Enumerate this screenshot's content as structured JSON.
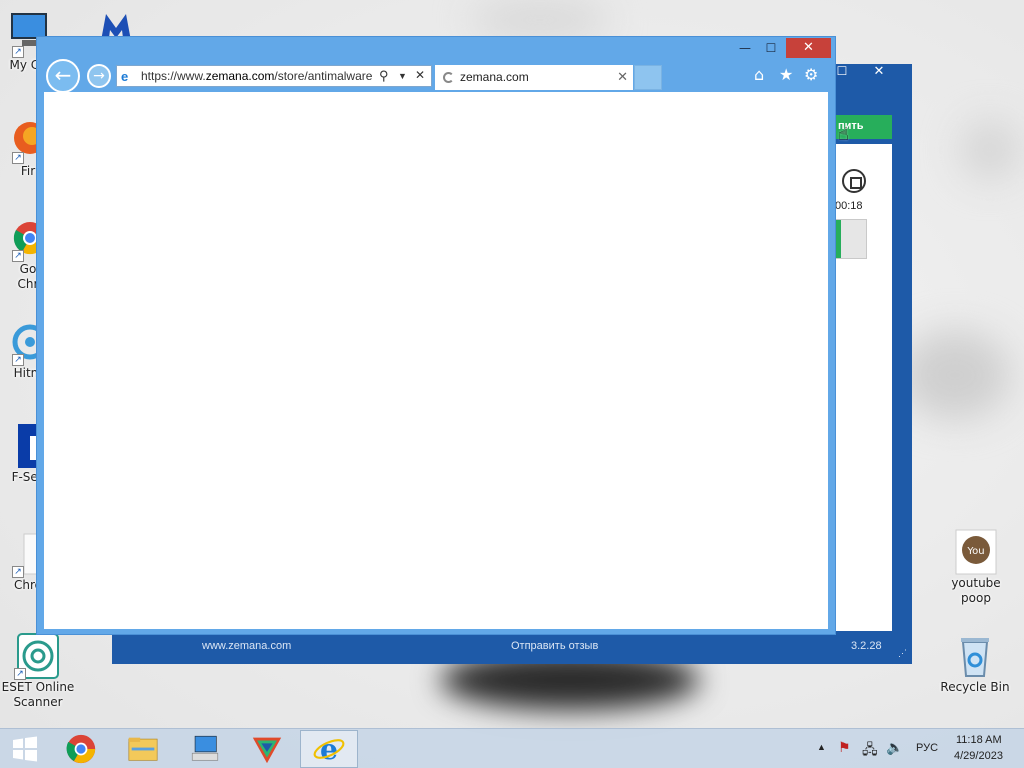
{
  "desktop": {
    "icons_left": [
      {
        "label": "My Co",
        "icon": "computer-icon"
      },
      {
        "label": "",
        "icon": "malwarebytes-icon"
      },
      {
        "label": "Fir",
        "icon": "firefox-icon"
      },
      {
        "label": "Go\nChr",
        "icon": "chrome-icon"
      },
      {
        "label": "Hitm",
        "icon": "hitmanpro-icon"
      },
      {
        "label": "F-Sec",
        "icon": "fsecure-icon"
      },
      {
        "label": "Chro",
        "icon": "chrome-file-icon"
      },
      {
        "label": "ESET Online\nScanner",
        "icon": "eset-icon"
      }
    ],
    "icons_right": [
      {
        "label": "youtube\npoop",
        "icon": "youtube-icon"
      },
      {
        "label": "Recycle Bin",
        "icon": "recycle-bin-icon"
      }
    ]
  },
  "zemana": {
    "scan_button_label": "пить",
    "timer": "00:18",
    "progress_fraction": 0.18,
    "footer": {
      "website": "www.zemana.com",
      "feedback": "Отправить отзыв",
      "version": "3.2.28"
    },
    "accent": "#1e5aa8",
    "green": "#27ae5b"
  },
  "ie": {
    "address_url_prefix": "https://www.",
    "address_url_domain": "zemana.com",
    "address_url_suffix": "/store/antimalware",
    "tab_title": "zemana.com",
    "caption_minimize": "—",
    "caption_maximize": "☐",
    "caption_close": "✕"
  },
  "taskbar": {
    "items": [
      "start-button",
      "chrome",
      "file-explorer",
      "control-panel",
      "zemana",
      "internet-explorer"
    ],
    "language": "РУС",
    "time": "11:18 AM",
    "date": "4/29/2023"
  }
}
